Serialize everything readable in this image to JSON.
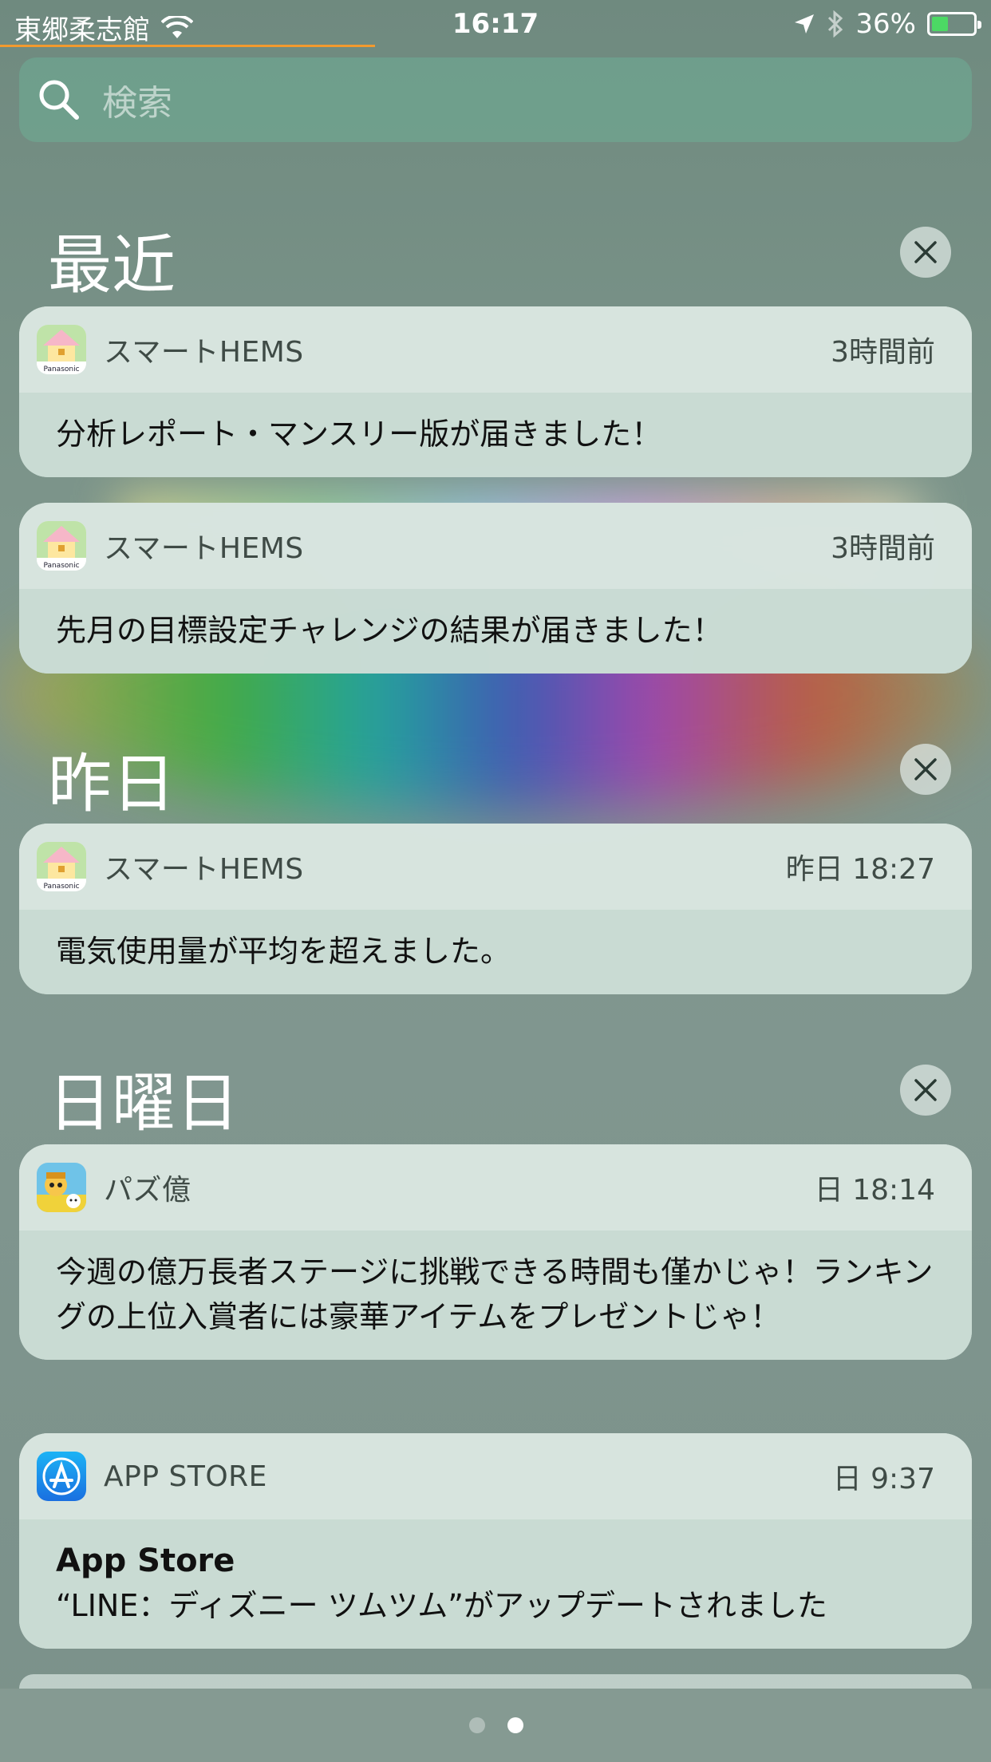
{
  "status": {
    "carrier": "東郷柔志館",
    "time": "16:17",
    "battery": "36%"
  },
  "search": {
    "placeholder": "検索"
  },
  "sections": [
    {
      "title": "最近"
    },
    {
      "title": "昨日"
    },
    {
      "title": "日曜日"
    }
  ],
  "notifications": [
    {
      "app": "スマートHEMS",
      "time": "3時間前",
      "body": "分析レポート・マンスリー版が届きました！"
    },
    {
      "app": "スマートHEMS",
      "time": "3時間前",
      "body": "先月の目標設定チャレンジの結果が届きました！"
    },
    {
      "app": "スマートHEMS",
      "time": "昨日 18:27",
      "body": "電気使用量が平均を超えました。"
    },
    {
      "app": "パズ億",
      "time": "日 18:14",
      "body": "今週の億万長者ステージに挑戦できる時間も僅かじゃ！ランキングの上位入賞者には豪華アイテムをプレゼントじゃ！"
    },
    {
      "app": "APP STORE",
      "time": "日 9:37",
      "title": "App Store",
      "body": "“LINE：ディズニー ツムツム”がアップデートされました"
    }
  ],
  "icons": {
    "hems": "house-icon",
    "puzzle": "character-icon",
    "appstore": "app-store-icon"
  },
  "colors": {
    "accent_loadbar": "#f29a2e",
    "battery_fill": "#4cd964"
  }
}
